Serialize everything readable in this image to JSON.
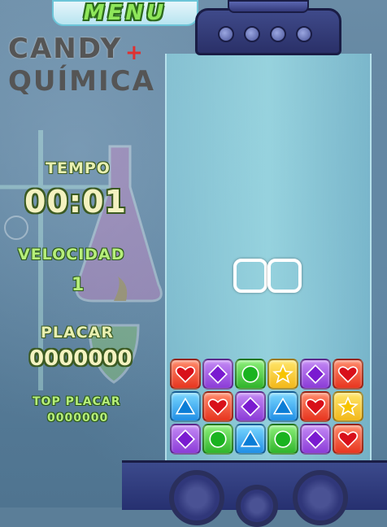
{
  "menu_label": "MENU",
  "logo": {
    "line1": "CANDY",
    "line2": "QUÍMICA",
    "plus": "+"
  },
  "stats": {
    "tempo_label": "TEMPO",
    "tempo_value": "00:01",
    "velocidad_label": "VELOCIDAD",
    "velocidad_value": "1",
    "placar_label": "PLACAR",
    "placar_value": "0000000",
    "top_label": "TOP PLACAR",
    "top_value": "0000000"
  },
  "board": {
    "rows": [
      [
        "heart",
        "diamond",
        "circle",
        "star",
        "diamond",
        "heart"
      ],
      [
        "triangle",
        "heart",
        "diamond",
        "triangle",
        "heart",
        "star"
      ],
      [
        "diamond",
        "circle",
        "triangle",
        "circle",
        "diamond",
        "heart"
      ]
    ]
  },
  "colors": {
    "background": "#5b7e98",
    "tube": "#9ee3ee",
    "machine": "#2f3878",
    "label": "#e8efb0"
  }
}
